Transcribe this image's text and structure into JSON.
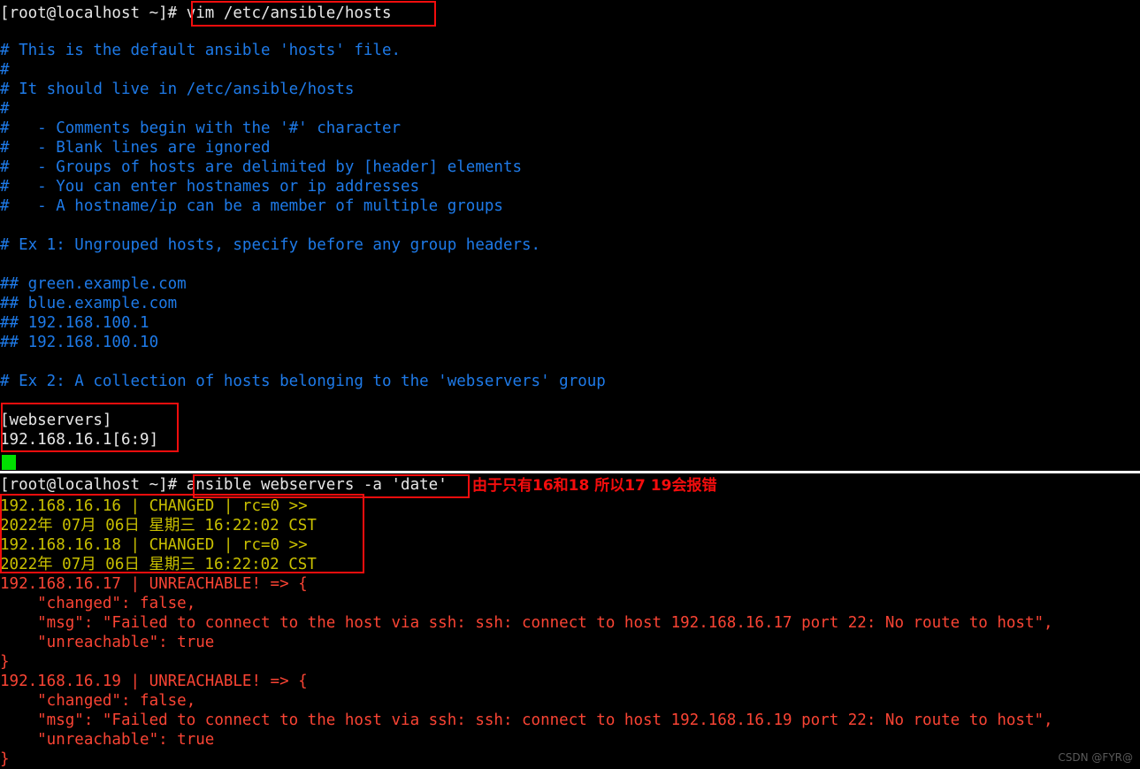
{
  "meta": {
    "terminal_bg": "#000000",
    "white": "#e8e8e8",
    "comment_blue": "#1e7ae8",
    "changed_yellow": "#c9c000",
    "error_red": "#fa4434",
    "annotation_red": "#f40d0d",
    "cursor_green": "#00e000"
  },
  "vim_session": {
    "prompt": "[root@localhost ~]# ",
    "command": "vim /etc/ansible/hosts",
    "lines": [
      "# This is the default ansible 'hosts' file.",
      "#",
      "# It should live in /etc/ansible/hosts",
      "#",
      "#   - Comments begin with the '#' character",
      "#   - Blank lines are ignored",
      "#   - Groups of hosts are delimited by [header] elements",
      "#   - You can enter hostnames or ip addresses",
      "#   - A hostname/ip can be a member of multiple groups",
      "",
      "# Ex 1: Ungrouped hosts, specify before any group headers.",
      "",
      "## green.example.com",
      "## blue.example.com",
      "## 192.168.100.1",
      "## 192.168.100.10",
      "",
      "# Ex 2: A collection of hosts belonging to the 'webservers' group",
      ""
    ],
    "group_block": {
      "header": "[webservers]",
      "hosts": "192.168.16.1[6:9]"
    }
  },
  "ansible_session": {
    "prompt": "[root@localhost ~]# ",
    "command": "ansible webservers -a 'date'",
    "annotation": "由于只有16和18 所以17 19会报错",
    "changed_output": [
      "192.168.16.16 | CHANGED | rc=0 >>",
      "2022年 07月 06日 星期三 16:22:02 CST",
      "192.168.16.18 | CHANGED | rc=0 >>",
      "2022年 07月 06日 星期三 16:22:02 CST"
    ],
    "unreachable_blocks": [
      [
        "192.168.16.17 | UNREACHABLE! => {",
        "    \"changed\": false,",
        "    \"msg\": \"Failed to connect to the host via ssh: ssh: connect to host 192.168.16.17 port 22: No route to host\",",
        "    \"unreachable\": true",
        "}"
      ],
      [
        "192.168.16.19 | UNREACHABLE! => {",
        "    \"changed\": false,",
        "    \"msg\": \"Failed to connect to the host via ssh: ssh: connect to host 192.168.16.19 port 22: No route to host\",",
        "    \"unreachable\": true",
        "}"
      ]
    ]
  },
  "watermark": "CSDN @FYR@"
}
